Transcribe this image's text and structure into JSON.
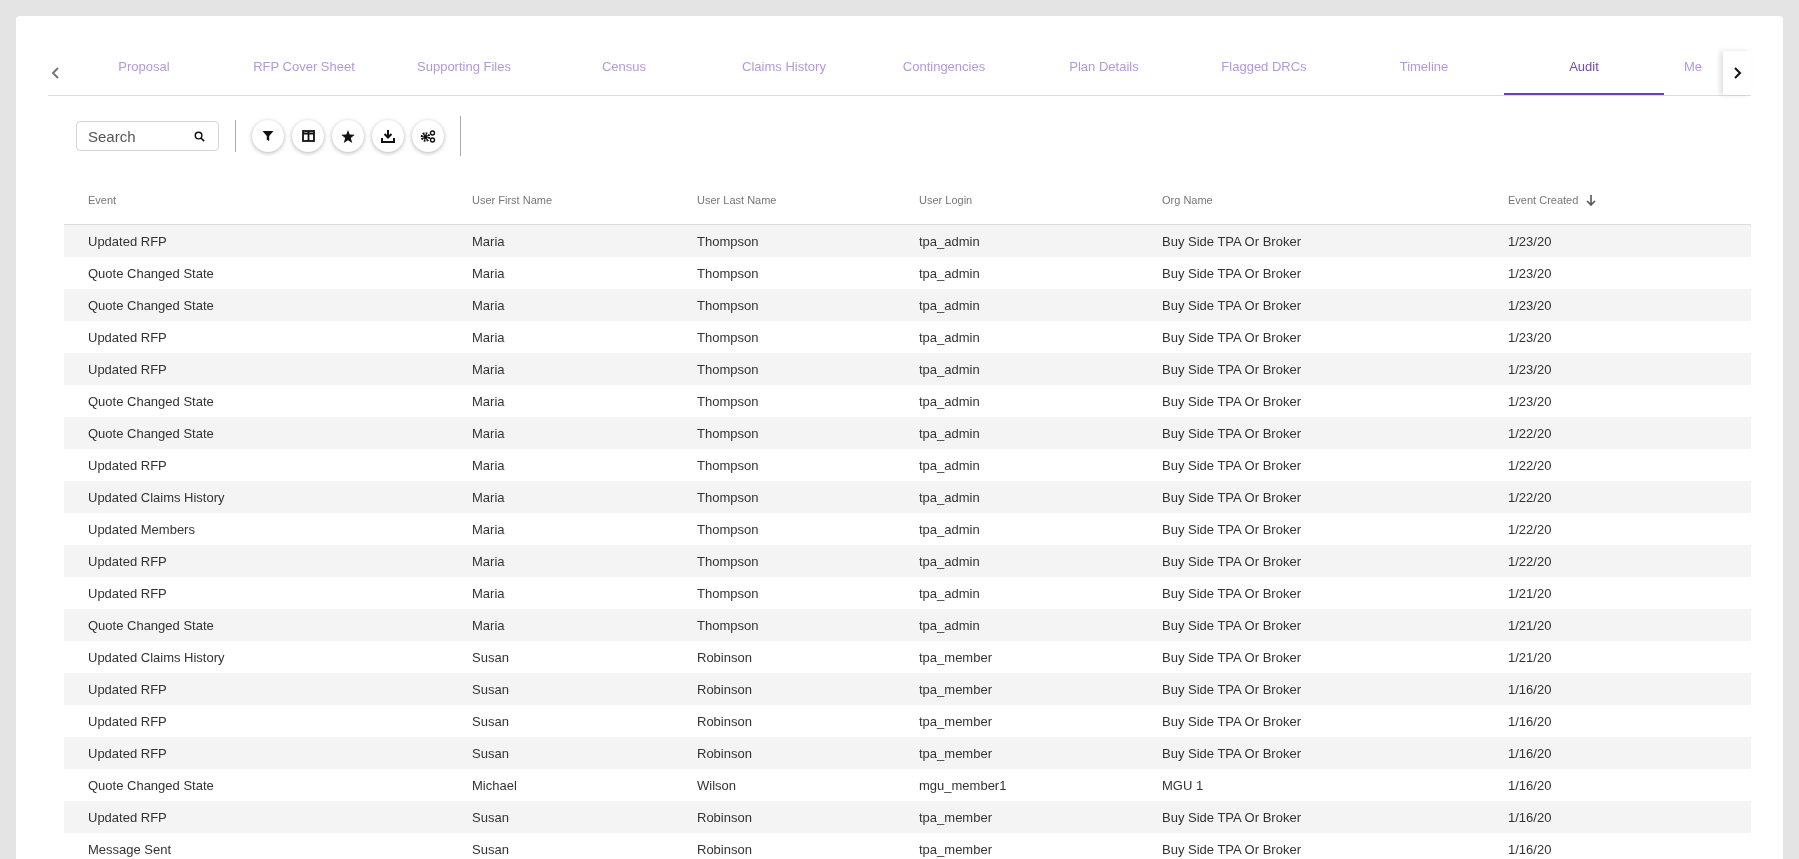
{
  "tabs": [
    {
      "label": "Proposal",
      "selected": false
    },
    {
      "label": "RFP Cover Sheet",
      "selected": false
    },
    {
      "label": "Supporting Files",
      "selected": false
    },
    {
      "label": "Census",
      "selected": false
    },
    {
      "label": "Claims History",
      "selected": false
    },
    {
      "label": "Contingencies",
      "selected": false
    },
    {
      "label": "Plan Details",
      "selected": false
    },
    {
      "label": "Flagged DRCs",
      "selected": false
    },
    {
      "label": "Timeline",
      "selected": false
    },
    {
      "label": "Audit",
      "selected": true
    },
    {
      "label": "Me",
      "selected": false
    }
  ],
  "search": {
    "placeholder": "Search"
  },
  "table": {
    "columns": [
      {
        "label": "Event",
        "sorted": false
      },
      {
        "label": "User First Name",
        "sorted": false
      },
      {
        "label": "User Last Name",
        "sorted": false
      },
      {
        "label": "User Login",
        "sorted": false
      },
      {
        "label": "Org Name",
        "sorted": false
      },
      {
        "label": "Event Created",
        "sorted": true
      }
    ],
    "rows": [
      [
        "Updated RFP",
        "Maria",
        "Thompson",
        "tpa_admin",
        "Buy Side TPA Or Broker",
        "1/23/20"
      ],
      [
        "Quote Changed State",
        "Maria",
        "Thompson",
        "tpa_admin",
        "Buy Side TPA Or Broker",
        "1/23/20"
      ],
      [
        "Quote Changed State",
        "Maria",
        "Thompson",
        "tpa_admin",
        "Buy Side TPA Or Broker",
        "1/23/20"
      ],
      [
        "Updated RFP",
        "Maria",
        "Thompson",
        "tpa_admin",
        "Buy Side TPA Or Broker",
        "1/23/20"
      ],
      [
        "Updated RFP",
        "Maria",
        "Thompson",
        "tpa_admin",
        "Buy Side TPA Or Broker",
        "1/23/20"
      ],
      [
        "Quote Changed State",
        "Maria",
        "Thompson",
        "tpa_admin",
        "Buy Side TPA Or Broker",
        "1/23/20"
      ],
      [
        "Quote Changed State",
        "Maria",
        "Thompson",
        "tpa_admin",
        "Buy Side TPA Or Broker",
        "1/22/20"
      ],
      [
        "Updated RFP",
        "Maria",
        "Thompson",
        "tpa_admin",
        "Buy Side TPA Or Broker",
        "1/22/20"
      ],
      [
        "Updated Claims History",
        "Maria",
        "Thompson",
        "tpa_admin",
        "Buy Side TPA Or Broker",
        "1/22/20"
      ],
      [
        "Updated Members",
        "Maria",
        "Thompson",
        "tpa_admin",
        "Buy Side TPA Or Broker",
        "1/22/20"
      ],
      [
        "Updated RFP",
        "Maria",
        "Thompson",
        "tpa_admin",
        "Buy Side TPA Or Broker",
        "1/22/20"
      ],
      [
        "Updated RFP",
        "Maria",
        "Thompson",
        "tpa_admin",
        "Buy Side TPA Or Broker",
        "1/21/20"
      ],
      [
        "Quote Changed State",
        "Maria",
        "Thompson",
        "tpa_admin",
        "Buy Side TPA Or Broker",
        "1/21/20"
      ],
      [
        "Updated Claims History",
        "Susan",
        "Robinson",
        "tpa_member",
        "Buy Side TPA Or Broker",
        "1/21/20"
      ],
      [
        "Updated RFP",
        "Susan",
        "Robinson",
        "tpa_member",
        "Buy Side TPA Or Broker",
        "1/16/20"
      ],
      [
        "Updated RFP",
        "Susan",
        "Robinson",
        "tpa_member",
        "Buy Side TPA Or Broker",
        "1/16/20"
      ],
      [
        "Updated RFP",
        "Susan",
        "Robinson",
        "tpa_member",
        "Buy Side TPA Or Broker",
        "1/16/20"
      ],
      [
        "Quote Changed State",
        "Michael",
        "Wilson",
        "mgu_member1",
        "MGU 1",
        "1/16/20"
      ],
      [
        "Updated RFP",
        "Susan",
        "Robinson",
        "tpa_member",
        "Buy Side TPA Or Broker",
        "1/16/20"
      ],
      [
        "Message Sent",
        "Susan",
        "Robinson",
        "tpa_member",
        "Buy Side TPA Or Broker",
        "1/16/20"
      ]
    ]
  }
}
